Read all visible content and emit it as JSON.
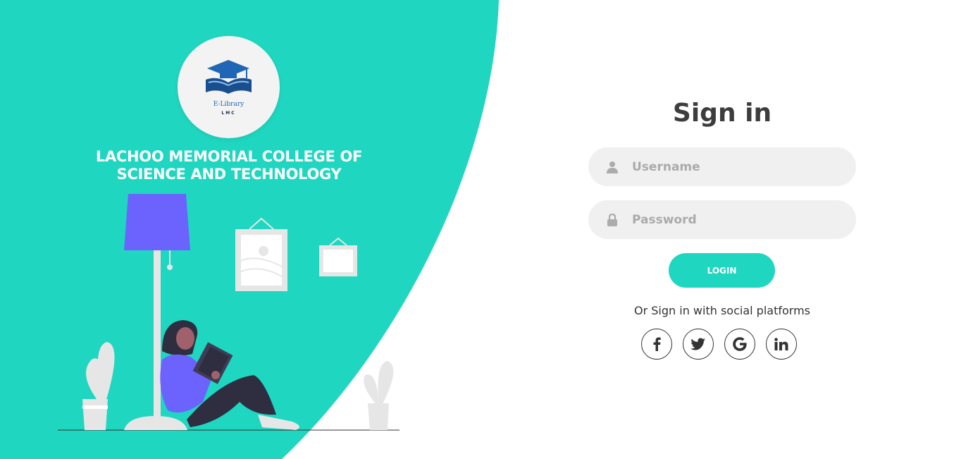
{
  "brand": {
    "logo_line1": "E-Library",
    "logo_line2": "LMC",
    "college_name": "LACHOO MEMORIAL COLLEGE OF SCIENCE AND TECHNOLOGY"
  },
  "colors": {
    "accent": "#1fd6c0",
    "illustration_lamp": "#6c63ff",
    "text_dark": "#3d3d3d"
  },
  "signin": {
    "title": "Sign in",
    "username_placeholder": "Username",
    "password_placeholder": "Password",
    "login_label": "LOGIN",
    "social_text": "Or Sign in with social platforms"
  },
  "social": [
    {
      "icon": "facebook-icon",
      "label": "f"
    },
    {
      "icon": "twitter-icon",
      "label": "twitter"
    },
    {
      "icon": "google-icon",
      "label": "G"
    },
    {
      "icon": "linkedin-icon",
      "label": "in"
    }
  ]
}
